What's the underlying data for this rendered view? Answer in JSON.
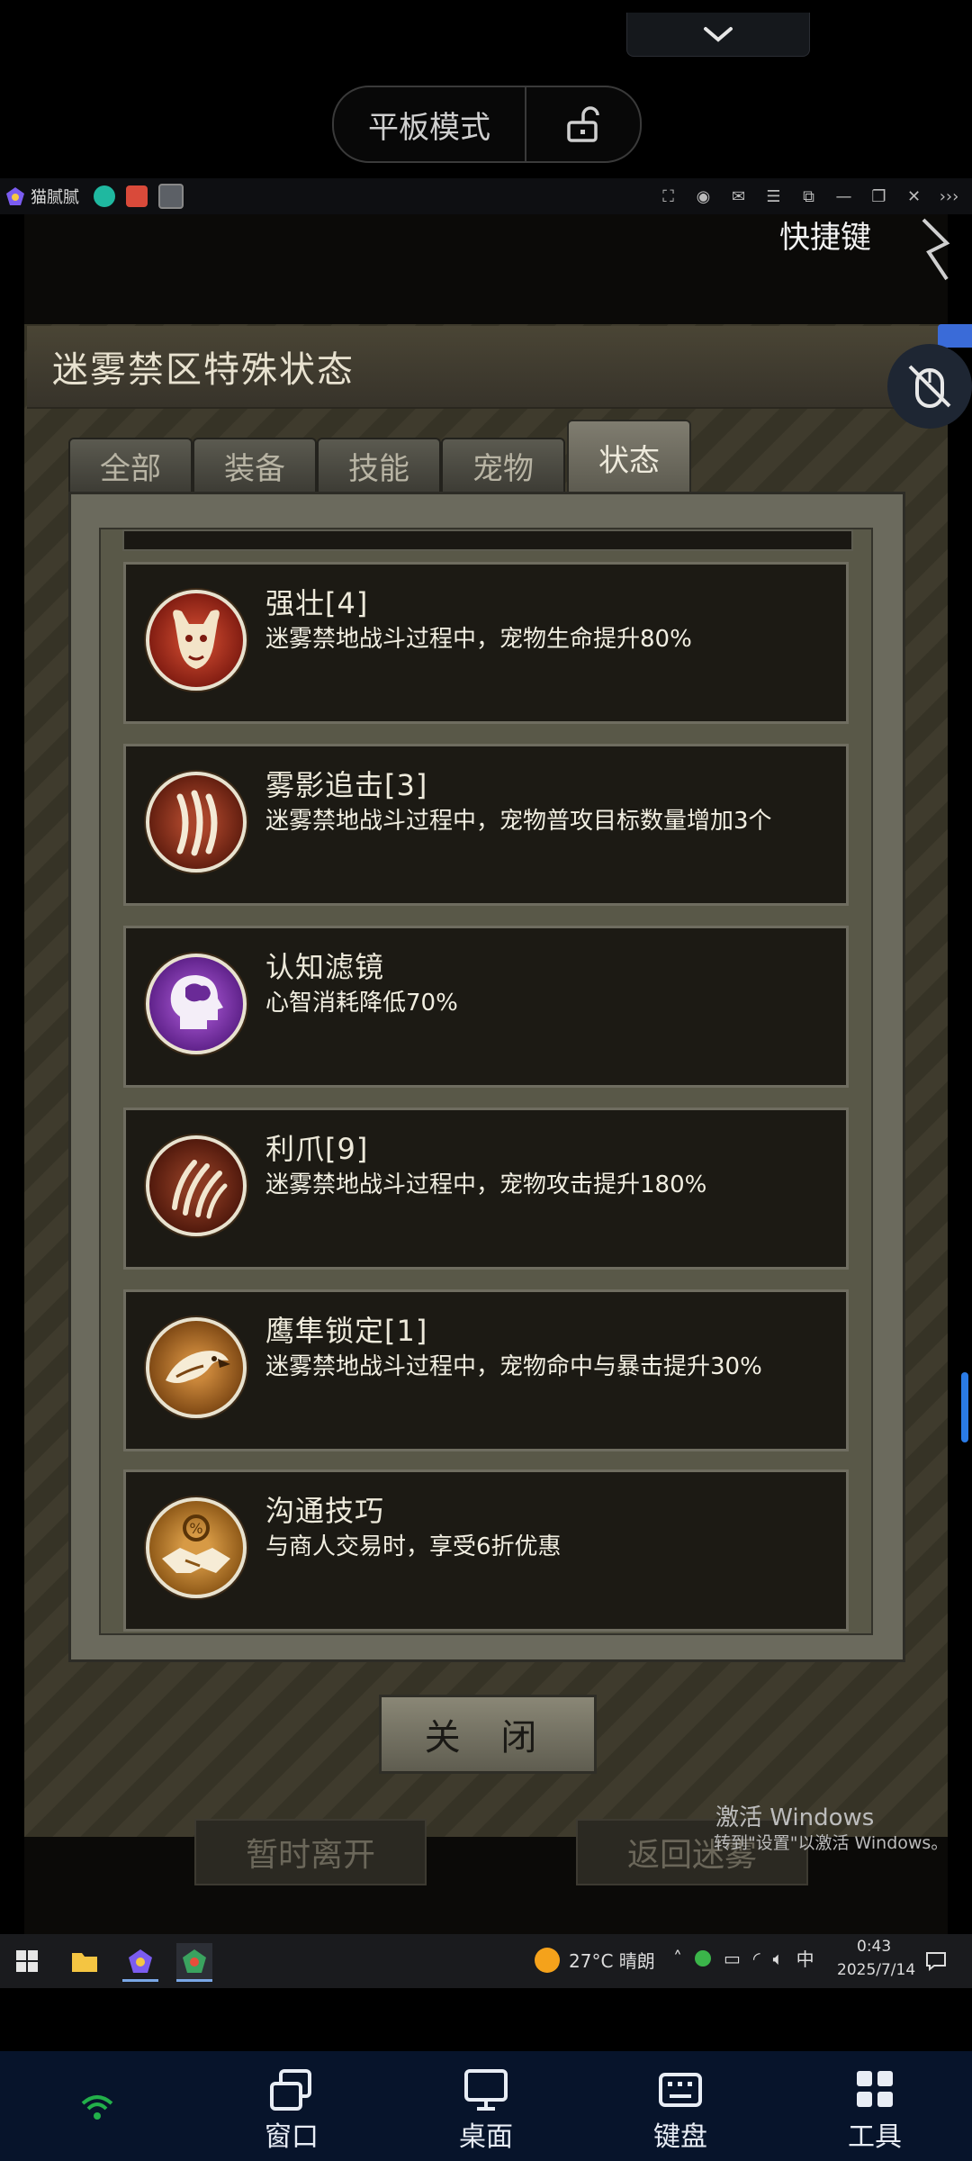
{
  "overlay": {
    "tablet_mode_label": "平板模式"
  },
  "emulator": {
    "app_name": "猫腻腻"
  },
  "game": {
    "hotkey_label": "快捷键",
    "panel_title": "迷雾禁区特殊状态",
    "tabs": [
      {
        "label": "全部",
        "active": false
      },
      {
        "label": "装备",
        "active": false
      },
      {
        "label": "技能",
        "active": false
      },
      {
        "label": "宠物",
        "active": false
      },
      {
        "label": "状态",
        "active": true
      }
    ],
    "statuses": [
      {
        "name": "强壮[4]",
        "desc": "迷雾禁地战斗过程中，宠物生命提升80%",
        "icon": "bull-icon"
      },
      {
        "name": "雾影追击[3]",
        "desc": "迷雾禁地战斗过程中，宠物普攻目标数量增加3个",
        "icon": "claw-slash-icon"
      },
      {
        "name": "认知滤镜",
        "desc": "心智消耗降低70%",
        "icon": "brain-head-icon"
      },
      {
        "name": "利爪[9]",
        "desc": "迷雾禁地战斗过程中，宠物攻击提升180%",
        "icon": "claws-icon"
      },
      {
        "name": "鹰隼锁定[1]",
        "desc": "迷雾禁地战斗过程中，宠物命中与暴击提升30%",
        "icon": "eagle-icon"
      },
      {
        "name": "沟通技巧",
        "desc": "与商人交易时，享受6折优惠",
        "icon": "handshake-icon"
      }
    ],
    "close_label": "关 闭",
    "under_buttons": [
      "暂时离开",
      "返回迷雾"
    ]
  },
  "windows": {
    "activate_title": "激活 Windows",
    "activate_sub": "转到\"设置\"以激活 Windows。",
    "weather": "27°C  晴朗",
    "ime": "中",
    "time": "0:43",
    "date": "2025/7/14"
  },
  "bottom_nav": [
    {
      "label": "窗口"
    },
    {
      "label": "桌面"
    },
    {
      "label": "键盘"
    },
    {
      "label": "工具"
    }
  ]
}
